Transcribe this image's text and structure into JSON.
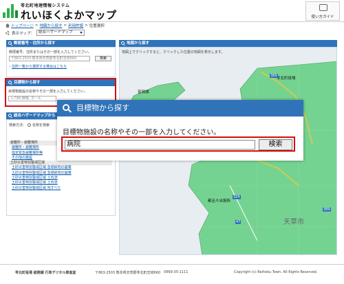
{
  "header": {
    "logo_subtitle": "苓北町地理情報システム",
    "logo_title": "れいほくよかマップ",
    "guide_label": "使い方ガイド"
  },
  "breadcrumb": {
    "home": "トップページ",
    "sep1": ">",
    "level2": "地図から探す",
    "sep2": ">",
    "level3": "利用許諾",
    "sep3": ">",
    "current": "位置選択"
  },
  "map_selector": {
    "label": "表示マップ：",
    "selected": "総合ハザードマップ"
  },
  "address_panel": {
    "title": "郵便番号・住所から探す",
    "desc": "郵便番号、住所またはその一部を入力してください。",
    "placeholder": "〒863-2503 熊本県天草郡苓北町志岐660",
    "search_button": "検索",
    "select_link": "住所一覧から選択する場合はこちら"
  },
  "landmark_panel": {
    "title": "目標物から探す",
    "desc": "目標物施設の名称やその一部を入力してください。",
    "placeholder": "入力例:宿場, ホール"
  },
  "hazard_panel": {
    "title": "総合ハザードマップから",
    "search_method": "検索方法：",
    "radio_label": "名称を検索",
    "categories": [
      {
        "name": "避難所・避難場所",
        "items": [
          "避難所・避難場所",
          "指定緊急避難場所等",
          "その他の施設"
        ]
      },
      {
        "name": "土砂災害特別警戒区域",
        "items": [
          "土砂災害特別警戒区域 急傾斜地の崩壊",
          "土砂災害特別警戒区域 急傾斜地の崩壊",
          "土砂災害特別警戒区域 土石流",
          "土砂災害特別警戒区域 土石流",
          "土砂災害特別警戒区域 地すべり"
        ]
      }
    ]
  },
  "map": {
    "hint": "地図上でクリックすると、クリックした位置の地図を表示します。",
    "labels": {
      "island": "富岡城",
      "office": "苓北町役場",
      "station": "都呂々出張所",
      "city": "天草市"
    },
    "road_numbers": [
      "389",
      "324",
      "389",
      "47"
    ]
  },
  "landmark_dialog": {
    "title": "目標物から探す",
    "desc": "目標物施設の名称やその一部を入力してください。",
    "input_value": "病院",
    "search_button": "検索"
  },
  "footer": {
    "org": "苓北町役場 総務課 行革デジタル推進室",
    "address": "〒863-2503 熊本県天草郡苓北町志岐660",
    "phone": "0969-35-1111",
    "copyright": "Copyright (c) Reihoku Town. All Rights Reserved."
  },
  "colors": {
    "header_blue": "#2f73ba",
    "highlight_red": "#d40c0c",
    "land_green": "#75d391",
    "sea": "#e8edf1"
  }
}
